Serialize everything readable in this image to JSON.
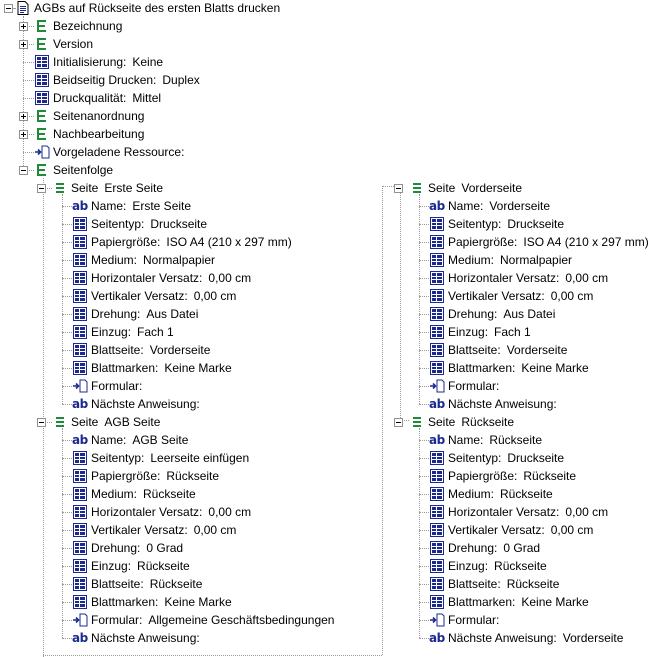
{
  "tree": {
    "root": {
      "label": "AGBs auf Rückseite des ersten Blatts drucken"
    },
    "top_items": [
      {
        "label": "Bezeichnung",
        "value": "",
        "icon": "green-list-icon",
        "expander": "plus"
      },
      {
        "label": "Version",
        "value": "",
        "icon": "green-list-icon",
        "expander": "plus"
      },
      {
        "label": "Initialisierung:",
        "value": "Keine",
        "icon": "property-grid-icon",
        "expander": ""
      },
      {
        "label": "Beidseitig Drucken:",
        "value": "Duplex",
        "icon": "property-grid-icon",
        "expander": ""
      },
      {
        "label": "Druckqualität:",
        "value": "Mittel",
        "icon": "property-grid-icon",
        "expander": ""
      },
      {
        "label": "Seitenanordnung",
        "value": "",
        "icon": "green-list-icon",
        "expander": "plus"
      },
      {
        "label": "Nachbearbeitung",
        "value": "",
        "icon": "green-list-icon",
        "expander": "plus"
      },
      {
        "label": "Vorgeladene Ressource:",
        "value": "",
        "icon": "resource-link-icon",
        "expander": ""
      },
      {
        "label": "Seitenfolge",
        "value": "",
        "icon": "green-list-icon",
        "expander": "minus"
      }
    ],
    "pages": [
      {
        "label": "Seite",
        "name": "Erste Seite",
        "props": [
          {
            "label": "Name:",
            "value": "Erste Seite",
            "icon": "ab-text-icon"
          },
          {
            "label": "Seitentyp:",
            "value": "Druckseite",
            "icon": "property-grid-icon"
          },
          {
            "label": "Papiergröße:",
            "value": "ISO A4 (210 x 297 mm)",
            "icon": "property-grid-icon"
          },
          {
            "label": "Medium:",
            "value": "Normalpapier",
            "icon": "property-grid-icon"
          },
          {
            "label": "Horizontaler Versatz:",
            "value": "0,00 cm",
            "icon": "property-grid-icon"
          },
          {
            "label": "Vertikaler Versatz:",
            "value": "0,00 cm",
            "icon": "property-grid-icon"
          },
          {
            "label": "Drehung:",
            "value": "Aus Datei",
            "icon": "property-grid-icon"
          },
          {
            "label": "Einzug:",
            "value": "Fach 1",
            "icon": "property-grid-icon"
          },
          {
            "label": "Blattseite:",
            "value": "Vorderseite",
            "icon": "property-grid-icon"
          },
          {
            "label": "Blattmarken:",
            "value": "Keine Marke",
            "icon": "property-grid-icon"
          },
          {
            "label": "Formular:",
            "value": "",
            "icon": "resource-link-icon"
          },
          {
            "label": "Nächste Anweisung:",
            "value": "",
            "icon": "ab-text-icon"
          }
        ]
      },
      {
        "label": "Seite",
        "name": "AGB Seite",
        "props": [
          {
            "label": "Name:",
            "value": "AGB Seite",
            "icon": "ab-text-icon"
          },
          {
            "label": "Seitentyp:",
            "value": "Leerseite einfügen",
            "icon": "property-grid-icon"
          },
          {
            "label": "Papiergröße:",
            "value": "Rückseite",
            "icon": "property-grid-icon"
          },
          {
            "label": "Medium:",
            "value": "Rückseite",
            "icon": "property-grid-icon"
          },
          {
            "label": "Horizontaler Versatz:",
            "value": "0,00 cm",
            "icon": "property-grid-icon"
          },
          {
            "label": "Vertikaler Versatz:",
            "value": "0,00 cm",
            "icon": "property-grid-icon"
          },
          {
            "label": "Drehung:",
            "value": "0 Grad",
            "icon": "property-grid-icon"
          },
          {
            "label": "Einzug:",
            "value": "Rückseite",
            "icon": "property-grid-icon"
          },
          {
            "label": "Blattseite:",
            "value": "Rückseite",
            "icon": "property-grid-icon"
          },
          {
            "label": "Blattmarken:",
            "value": "Keine Marke",
            "icon": "property-grid-icon"
          },
          {
            "label": "Formular:",
            "value": "Allgemeine Geschäftsbedingungen",
            "icon": "resource-link-icon"
          },
          {
            "label": "Nächste Anweisung:",
            "value": "",
            "icon": "ab-text-icon"
          }
        ]
      },
      {
        "label": "Seite",
        "name": "Vorderseite",
        "props": [
          {
            "label": "Name:",
            "value": "Vorderseite",
            "icon": "ab-text-icon"
          },
          {
            "label": "Seitentyp:",
            "value": "Druckseite",
            "icon": "property-grid-icon"
          },
          {
            "label": "Papiergröße:",
            "value": "ISO A4 (210 x 297 mm)",
            "icon": "property-grid-icon"
          },
          {
            "label": "Medium:",
            "value": "Normalpapier",
            "icon": "property-grid-icon"
          },
          {
            "label": "Horizontaler Versatz:",
            "value": "0,00 cm",
            "icon": "property-grid-icon"
          },
          {
            "label": "Vertikaler Versatz:",
            "value": "0,00 cm",
            "icon": "property-grid-icon"
          },
          {
            "label": "Drehung:",
            "value": "Aus Datei",
            "icon": "property-grid-icon"
          },
          {
            "label": "Einzug:",
            "value": "Fach 1",
            "icon": "property-grid-icon"
          },
          {
            "label": "Blattseite:",
            "value": "Vorderseite",
            "icon": "property-grid-icon"
          },
          {
            "label": "Blattmarken:",
            "value": "Keine Marke",
            "icon": "property-grid-icon"
          },
          {
            "label": "Formular:",
            "value": "",
            "icon": "resource-link-icon"
          },
          {
            "label": "Nächste Anweisung:",
            "value": "",
            "icon": "ab-text-icon"
          }
        ]
      },
      {
        "label": "Seite",
        "name": "Rückseite",
        "props": [
          {
            "label": "Name:",
            "value": "Rückseite",
            "icon": "ab-text-icon"
          },
          {
            "label": "Seitentyp:",
            "value": "Druckseite",
            "icon": "property-grid-icon"
          },
          {
            "label": "Papiergröße:",
            "value": "Rückseite",
            "icon": "property-grid-icon"
          },
          {
            "label": "Medium:",
            "value": "Rückseite",
            "icon": "property-grid-icon"
          },
          {
            "label": "Horizontaler Versatz:",
            "value": "0,00 cm",
            "icon": "property-grid-icon"
          },
          {
            "label": "Vertikaler Versatz:",
            "value": "0,00 cm",
            "icon": "property-grid-icon"
          },
          {
            "label": "Drehung:",
            "value": "0 Grad",
            "icon": "property-grid-icon"
          },
          {
            "label": "Einzug:",
            "value": "Rückseite",
            "icon": "property-grid-icon"
          },
          {
            "label": "Blattseite:",
            "value": "Rückseite",
            "icon": "property-grid-icon"
          },
          {
            "label": "Blattmarken:",
            "value": "Keine Marke",
            "icon": "property-grid-icon"
          },
          {
            "label": "Formular:",
            "value": "",
            "icon": "resource-link-icon"
          },
          {
            "label": "Nächste Anweisung:",
            "value": "Vorderseite",
            "icon": "ab-text-icon"
          }
        ]
      }
    ]
  },
  "colors": {
    "green_icon": "#1f8a3a",
    "grid_icon": "#1b2a8f",
    "tree_line": "#9a9a9a",
    "ab_text": "#1b2a8f"
  }
}
